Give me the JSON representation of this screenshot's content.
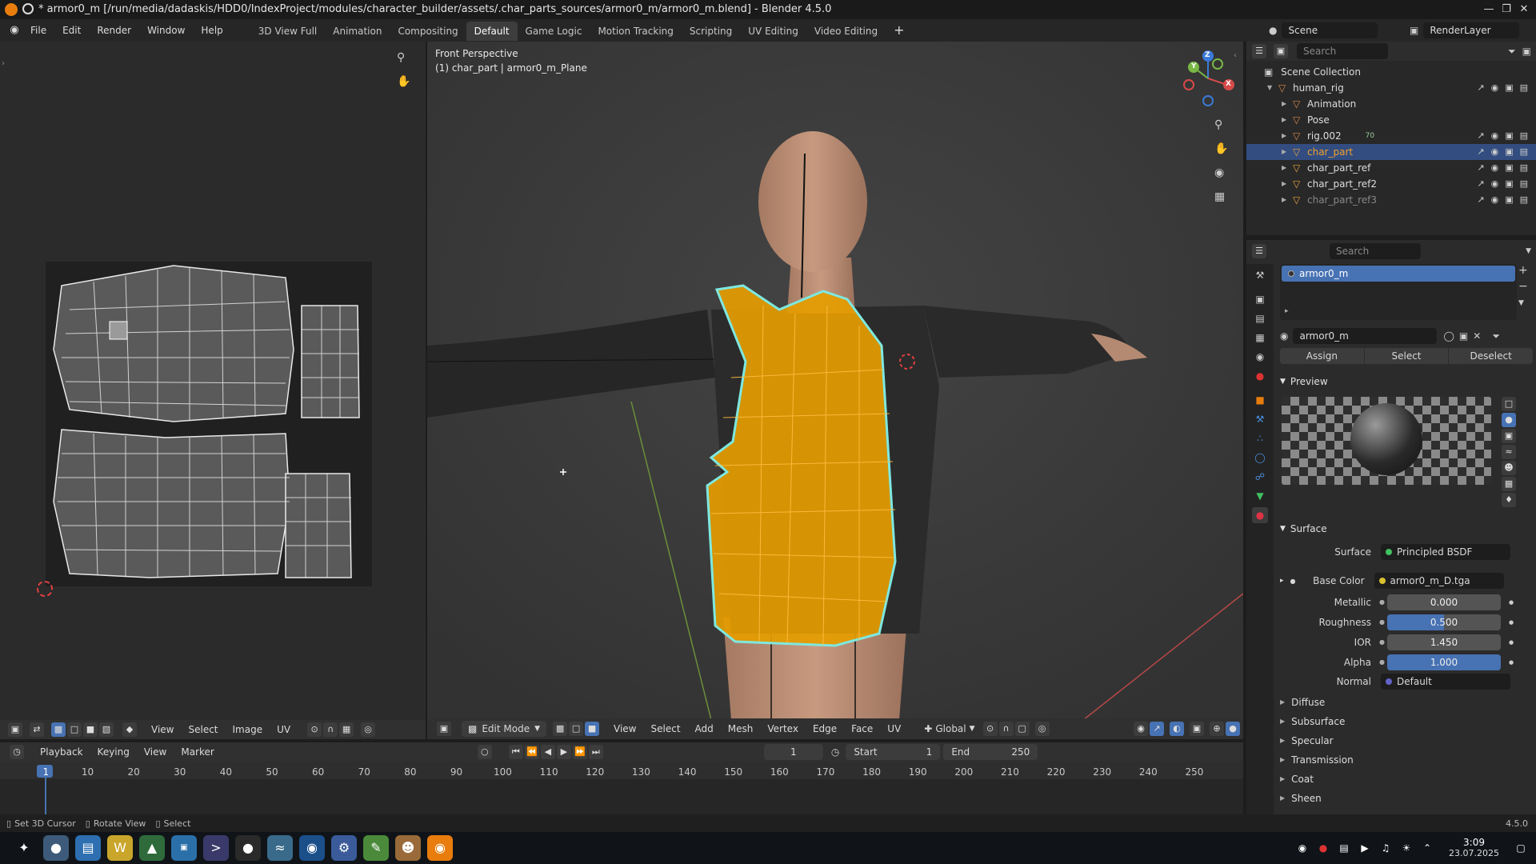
{
  "window": {
    "title": "* armor0_m [/run/media/dadaskis/HDD0/IndexProject/modules/character_builder/assets/.char_parts_sources/armor0_m/armor0_m.blend] - Blender 4.5.0"
  },
  "menu": [
    "File",
    "Edit",
    "Render",
    "Window",
    "Help"
  ],
  "workspaces": [
    "3D View Full",
    "Animation",
    "Compositing",
    "Default",
    "Game Logic",
    "Motion Tracking",
    "Scripting",
    "UV Editing",
    "Video Editing"
  ],
  "active_workspace": "Default",
  "scene": {
    "name": "Scene",
    "render_layer": "RenderLayer"
  },
  "uv_editor": {
    "header": [
      "View",
      "Select",
      "Image",
      "UV"
    ]
  },
  "viewport": {
    "overlay_title": "Front Perspective",
    "overlay_object": "(1) char_part | armor0_m_Plane",
    "mode": "Edit Mode",
    "header": [
      "View",
      "Select",
      "Add",
      "Mesh",
      "Vertex",
      "Edge",
      "Face",
      "UV"
    ],
    "transform": "Global",
    "gizmo": {
      "z": "Z",
      "y": "Y",
      "x": "X"
    }
  },
  "timeline": {
    "header": [
      "Playback",
      "Keying",
      "View",
      "Marker"
    ],
    "current_frame": "1",
    "start_label": "Start",
    "start": "1",
    "end_label": "End",
    "end": "250",
    "ticks": [
      "1",
      "10",
      "20",
      "30",
      "40",
      "50",
      "60",
      "70",
      "80",
      "90",
      "100",
      "110",
      "120",
      "130",
      "140",
      "150",
      "160",
      "170",
      "180",
      "190",
      "200",
      "210",
      "220",
      "230",
      "240",
      "250"
    ]
  },
  "status": {
    "items": [
      "Set 3D Cursor",
      "Rotate View",
      "Select"
    ],
    "version": "4.5.0"
  },
  "outliner": {
    "search_placeholder": "Search",
    "root": "Scene Collection",
    "items": [
      {
        "name": "human_rig",
        "indent": 1
      },
      {
        "name": "Animation",
        "indent": 2
      },
      {
        "name": "Pose",
        "indent": 2
      },
      {
        "name": "rig.002",
        "indent": 2
      },
      {
        "name": "char_part",
        "indent": 2,
        "selected": true
      },
      {
        "name": "char_part_ref",
        "indent": 2
      },
      {
        "name": "char_part_ref2",
        "indent": 2
      },
      {
        "name": "char_part_ref3",
        "indent": 2
      }
    ],
    "rig_badge": "70"
  },
  "properties": {
    "search_placeholder": "Search",
    "material_slot": "armor0_m",
    "material_name": "armor0_m",
    "buttons": [
      "Assign",
      "Select",
      "Deselect"
    ],
    "preview_label": "Preview",
    "surface_label": "Surface",
    "surface_shader_label": "Surface",
    "surface_shader": "Principled BSDF",
    "base_color_label": "Base Color",
    "base_color": "armor0_m_D.tga",
    "fields": [
      {
        "label": "Metallic",
        "value": "0.000",
        "fill": 0.0
      },
      {
        "label": "Roughness",
        "value": "0.500",
        "fill": 0.5
      },
      {
        "label": "IOR",
        "value": "1.450",
        "fill": 0.0
      },
      {
        "label": "Alpha",
        "value": "1.000",
        "fill": 1.0
      }
    ],
    "normal_label": "Normal",
    "normal": "Default",
    "subsections": [
      "Diffuse",
      "Subsurface",
      "Specular",
      "Transmission",
      "Coat",
      "Sheen"
    ]
  },
  "taskbar": {
    "time": "3:09",
    "date": "23.07.2025"
  },
  "colors": {
    "accent": "#4772b3",
    "selected_mesh": "#e59c00",
    "edge_highlight": "#7ee8e0"
  }
}
